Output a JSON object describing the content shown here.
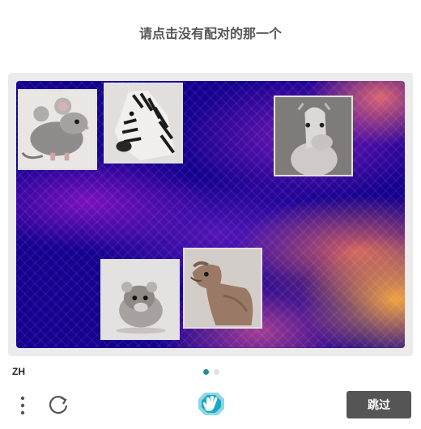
{
  "prompt": "请点击没有配对的那一个",
  "tiles": [
    {
      "icon": "mouse-photo"
    },
    {
      "icon": "zebra-photo"
    },
    {
      "icon": "camel-photo"
    },
    {
      "icon": "hamster-photo"
    },
    {
      "icon": "camel-photo"
    }
  ],
  "footer": {
    "language": "ZH",
    "skip_label": "跳过",
    "page_indicator": {
      "current": 1,
      "total": 2
    }
  },
  "colors": {
    "accent": "#2a8a96",
    "skip_button": "#555555",
    "logo": "#1aa9c4"
  }
}
